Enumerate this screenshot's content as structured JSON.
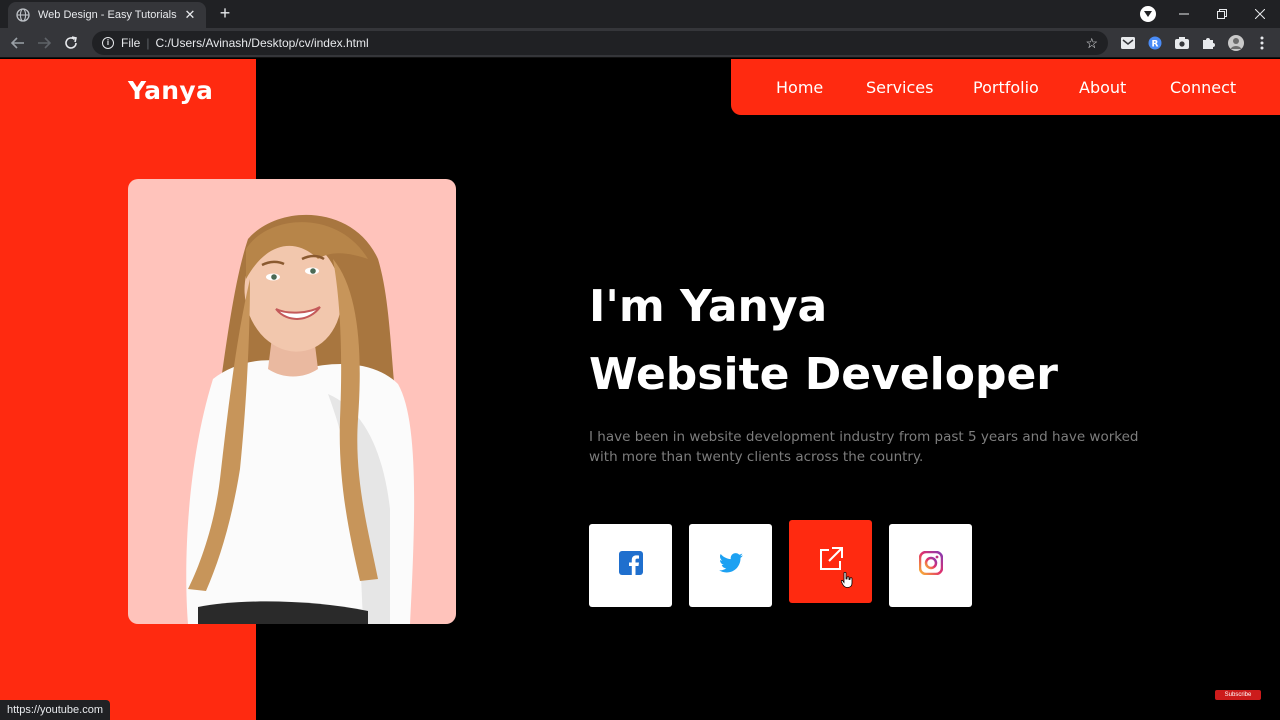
{
  "browser": {
    "tab_title": "Web Design - Easy Tutorials",
    "url_scheme": "File",
    "url": "C:/Users/Avinash/Desktop/cv/index.html",
    "status_link": "https://youtube.com",
    "subscribe_badge": "Subscribe"
  },
  "site": {
    "logo": "Yanya",
    "nav": [
      "Home",
      "Services",
      "Portfolio",
      "About",
      "Connect"
    ],
    "hero": {
      "line1": "I'm Yanya",
      "line2": "Website Developer",
      "description": "I have been in website development industry from past 5 years and have worked with more than twenty clients across the country."
    },
    "social": [
      {
        "name": "facebook-icon",
        "color": "#1f6fce"
      },
      {
        "name": "twitter-icon",
        "color": "#1da1f2"
      },
      {
        "name": "external-link-icon",
        "color": "#ffffff"
      },
      {
        "name": "instagram-icon",
        "color": "#e1306c"
      }
    ]
  },
  "colors": {
    "accent": "#ff2a10",
    "photo_bg": "#ffc3bb",
    "background": "#000000"
  }
}
